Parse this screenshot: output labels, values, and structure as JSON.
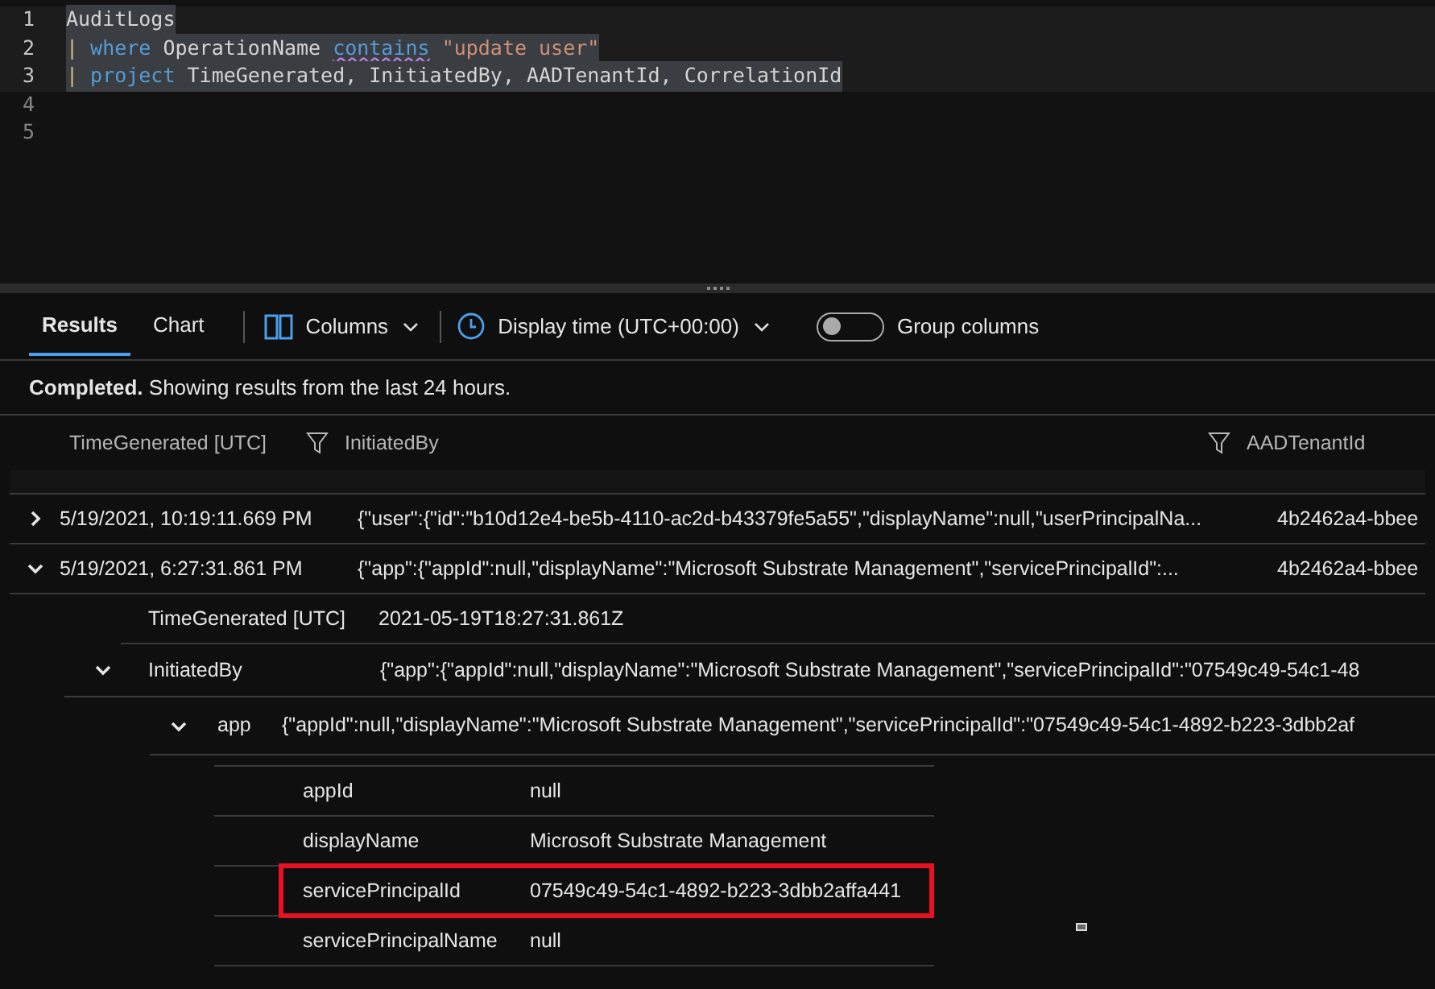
{
  "editor": {
    "lines": [
      {
        "number": "1",
        "selected": true,
        "tokens": [
          {
            "kind": "plain",
            "text": "AuditLogs"
          }
        ]
      },
      {
        "number": "2",
        "selected": true,
        "tokens": [
          {
            "kind": "pipe",
            "text": "|"
          },
          {
            "kind": "keyword",
            "text": " where"
          },
          {
            "kind": "plain",
            "text": " OperationName "
          },
          {
            "kind": "warning",
            "text": "contains"
          },
          {
            "kind": "string",
            "text": " \"update user\""
          }
        ]
      },
      {
        "number": "3",
        "selected": true,
        "tokens": [
          {
            "kind": "pipe",
            "text": "|"
          },
          {
            "kind": "keyword",
            "text": " project"
          },
          {
            "kind": "plain",
            "text": " TimeGenerated, InitiatedBy, AADTenantId, CorrelationId"
          }
        ]
      },
      {
        "number": "4",
        "selected": false
      },
      {
        "number": "5",
        "selected": false
      }
    ]
  },
  "tabs": [
    {
      "label": "Results",
      "selected": true
    },
    {
      "label": "Chart",
      "selected": false
    }
  ],
  "toolbar": {
    "columns": "Columns",
    "display_time": "Display time (UTC+00:00)",
    "group_columns": {
      "label": "Group columns",
      "on": false
    }
  },
  "status": "**Completed.** Showing results from the last 24 hours.",
  "table": {
    "columns": [
      "TimeGenerated [UTC]",
      "InitiatedBy",
      "AADTenantId"
    ],
    "rows": [
      {
        "expanded": false,
        "cells": [
          "5/19/2021, 10:19:11.669 PM",
          "{\"user\":{\"id\":\"b10d12e4-be5b-4110-ac2d-b43379fe5a55\",\"displayName\":null,\"userPrincipalNa...",
          "4b2462a4-bbee"
        ]
      },
      {
        "expanded": true,
        "cells": [
          "5/19/2021, 6:27:31.861 PM",
          "{\"app\":{\"appId\":null,\"displayName\":\"Microsoft Substrate Management\",\"servicePrincipalId\":...",
          "4b2462a4-bbee"
        ]
      }
    ]
  },
  "detail": {
    "time": {
      "key": "TimeGenerated [UTC]",
      "value": "2021-05-19T18:27:31.861Z"
    },
    "initiated_by": {
      "key": "InitiatedBy",
      "expanded": true,
      "value": "{\"app\":{\"appId\":null,\"displayName\":\"Microsoft Substrate Management\",\"servicePrincipalId\":\"07549c49-54c1-48"
    },
    "app": {
      "key": "app",
      "expanded": true,
      "value": "{\"appId\":null,\"displayName\":\"Microsoft Substrate Management\",\"servicePrincipalId\":\"07549c49-54c1-4892-b223-3dbb2af"
    },
    "fields": [
      {
        "key": "appId",
        "value": "null",
        "highlighted": false
      },
      {
        "key": "displayName",
        "value": "Microsoft Substrate Management",
        "highlighted": false
      },
      {
        "key": "servicePrincipalId",
        "value": "07549c49-54c1-4892-b223-3dbb2affa441",
        "highlighted": true
      },
      {
        "key": "servicePrincipalName",
        "value": "null",
        "highlighted": false
      }
    ]
  }
}
